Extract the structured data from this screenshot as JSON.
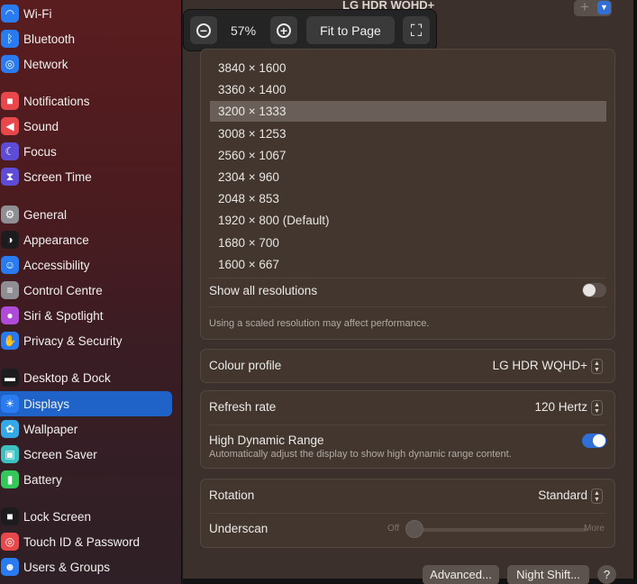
{
  "sidebar": {
    "items": [
      {
        "label": "Wi-Fi",
        "icon": "wifi-icon",
        "glyph": "◠",
        "color": "#2a7bf0"
      },
      {
        "label": "Bluetooth",
        "icon": "bluetooth-icon",
        "glyph": "ᛒ",
        "color": "#2a7bf0"
      },
      {
        "label": "Network",
        "icon": "globe-icon",
        "glyph": "◎",
        "color": "#2a7bf0"
      },
      {
        "label": "Notifications",
        "icon": "bell-icon",
        "glyph": "■",
        "color": "#e8484b"
      },
      {
        "label": "Sound",
        "icon": "speaker-icon",
        "glyph": "◀",
        "color": "#e8484b"
      },
      {
        "label": "Focus",
        "icon": "moon-icon",
        "glyph": "☾",
        "color": "#5e4bd6"
      },
      {
        "label": "Screen Time",
        "icon": "hourglass-icon",
        "glyph": "⧗",
        "color": "#5e4bd6"
      },
      {
        "label": "General",
        "icon": "gear-icon",
        "glyph": "⚙",
        "color": "#8e8e93"
      },
      {
        "label": "Appearance",
        "icon": "appearance-icon",
        "glyph": "◑",
        "color": "#1c1c1e"
      },
      {
        "label": "Accessibility",
        "icon": "accessibility-icon",
        "glyph": "☺",
        "color": "#2a7bf0"
      },
      {
        "label": "Control Centre",
        "icon": "control-centre-icon",
        "glyph": "≡",
        "color": "#8e8e93"
      },
      {
        "label": "Siri & Spotlight",
        "icon": "siri-icon",
        "glyph": "●",
        "color": "#b04ad8"
      },
      {
        "label": "Privacy & Security",
        "icon": "hand-icon",
        "glyph": "✋",
        "color": "#2a7bf0"
      },
      {
        "label": "Desktop & Dock",
        "icon": "dock-icon",
        "glyph": "▬",
        "color": "#1c1c1e"
      },
      {
        "label": "Displays",
        "icon": "sun-icon",
        "glyph": "☀",
        "color": "#2a7bf0"
      },
      {
        "label": "Wallpaper",
        "icon": "flower-icon",
        "glyph": "✿",
        "color": "#35a8e8"
      },
      {
        "label": "Screen Saver",
        "icon": "screen-saver-icon",
        "glyph": "▣",
        "color": "#3cc1c0"
      },
      {
        "label": "Battery",
        "icon": "battery-icon",
        "glyph": "▮",
        "color": "#34c759"
      },
      {
        "label": "Lock Screen",
        "icon": "lock-icon",
        "glyph": "■",
        "color": "#1c1c1e"
      },
      {
        "label": "Touch ID & Password",
        "icon": "fingerprint-icon",
        "glyph": "◎",
        "color": "#e8484b"
      },
      {
        "label": "Users & Groups",
        "icon": "users-icon",
        "glyph": "☻",
        "color": "#2a7bf0"
      }
    ],
    "active": "Displays"
  },
  "header": {
    "title": "LG HDR WQHD+",
    "add_label": "+"
  },
  "zoom": {
    "percent": "57%",
    "fit_label": "Fit to Page"
  },
  "resolutions": {
    "items": [
      "3840 × 1600",
      "3360 × 1400",
      "3200 × 1333",
      "3008 × 1253",
      "2560 × 1067",
      "2304 × 960",
      "2048 × 853",
      "1920 × 800 (Default)",
      "1680 × 700",
      "1600 × 667"
    ],
    "selected": "3200 × 1333",
    "show_all_label": "Show all resolutions",
    "show_all_on": false,
    "note": "Using a scaled resolution may affect performance."
  },
  "colour_profile": {
    "label": "Colour profile",
    "value": "LG HDR WQHD+"
  },
  "refresh": {
    "label": "Refresh rate",
    "value": "120 Hertz"
  },
  "hdr": {
    "label": "High Dynamic Range",
    "description": "Automatically adjust the display to show high dynamic range content.",
    "on": true
  },
  "rotation": {
    "label": "Rotation",
    "value": "Standard"
  },
  "underscan": {
    "label": "Underscan",
    "min_label": "Off",
    "max_label": "More",
    "level": 0
  },
  "buttons": {
    "advanced": "Advanced...",
    "night_shift": "Night Shift...",
    "help": "?"
  },
  "colors": {
    "accent": "#2f6fd6",
    "selection": "#1f63c9"
  }
}
